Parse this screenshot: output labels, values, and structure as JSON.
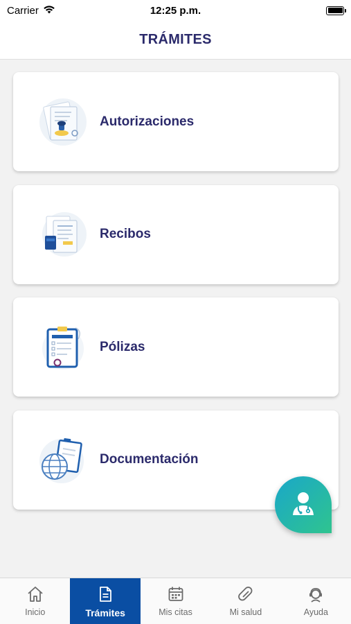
{
  "status_bar": {
    "carrier": "Carrier",
    "time": "12:25 p.m."
  },
  "header": {
    "title": "TRÁMITES"
  },
  "cards": [
    {
      "label": "Autorizaciones",
      "icon": "authorization-stamp-icon"
    },
    {
      "label": "Recibos",
      "icon": "receipt-icon"
    },
    {
      "label": "Pólizas",
      "icon": "insurance-policy-icon"
    },
    {
      "label": "Documentación",
      "icon": "documents-globe-icon"
    }
  ],
  "fab": {
    "icon": "doctor-icon"
  },
  "tabs": [
    {
      "label": "Inicio",
      "icon": "home-icon",
      "active": false
    },
    {
      "label": "Trámites",
      "icon": "document-icon",
      "active": true
    },
    {
      "label": "Mis citas",
      "icon": "calendar-icon",
      "active": false
    },
    {
      "label": "Mi salud",
      "icon": "pill-icon",
      "active": false
    },
    {
      "label": "Ayuda",
      "icon": "support-agent-icon",
      "active": false
    }
  ],
  "colors": {
    "primary": "#2b2a6b",
    "tab_active": "#0a4ea3",
    "fab_gradient_start": "#1aa7c9",
    "fab_gradient_end": "#2fc48f"
  }
}
